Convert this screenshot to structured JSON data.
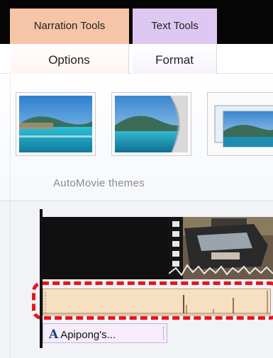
{
  "contextual_tabs": {
    "narration": "Narration Tools",
    "text": "Text Tools"
  },
  "ribbon_tabs": {
    "options": "Options",
    "format": "Format"
  },
  "ribbon": {
    "group_label": "AutoMovie themes",
    "themes": [
      {
        "icon": "theme-thumbnail-icon"
      },
      {
        "icon": "theme-thumbnail-icon"
      },
      {
        "icon": "theme-thumbnail-icon"
      }
    ]
  },
  "timeline": {
    "caption_icon": "A",
    "caption_text": "Apipong's..."
  },
  "colors": {
    "narration_tab": "#f6c4a6",
    "text_tab": "#dcc8f0",
    "audio_track": "#f7dfc2",
    "highlight": "#e8141c",
    "caption_bg": "#f6ecfa"
  }
}
